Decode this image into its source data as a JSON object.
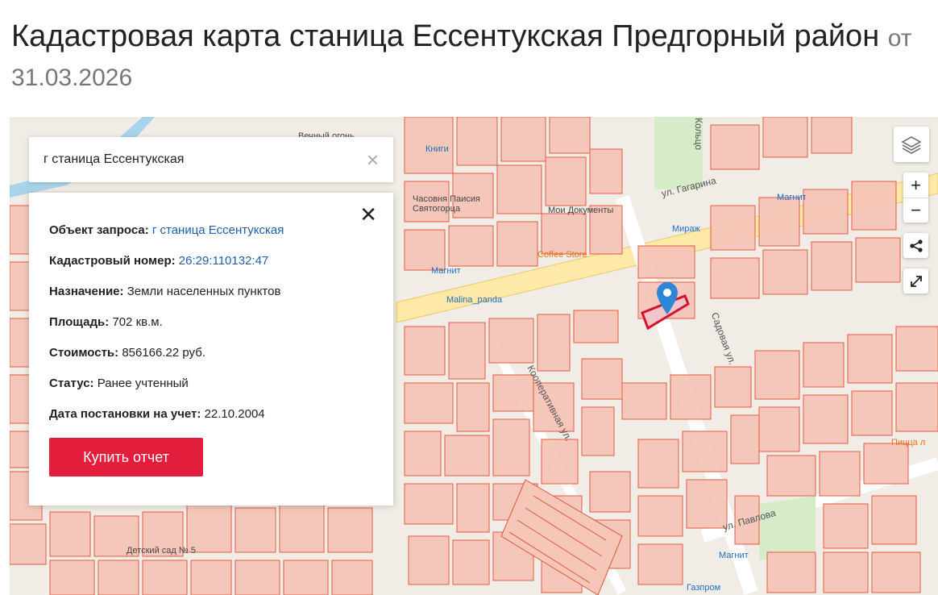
{
  "header": {
    "title": "Кадастровая карта станица Ессентукская Предгорный район",
    "date_text": "от 31.03.2026"
  },
  "search": {
    "value": "г станица Ессентукская",
    "clear_glyph": "×"
  },
  "info": {
    "close_glyph": "✕",
    "rows": [
      {
        "label": "Объект запроса:",
        "value": "г станица Ессентукская",
        "link": true
      },
      {
        "label": "Кадастровый номер:",
        "value": "26:29:110132:47",
        "link": true
      },
      {
        "label": "Назначение:",
        "value": "Земли населенных пунктов",
        "link": false
      },
      {
        "label": "Площадь:",
        "value": "702 кв.м.",
        "link": false
      },
      {
        "label": "Стоимость:",
        "value": "856166.22 руб.",
        "link": false
      },
      {
        "label": "Статус:",
        "value": "Ранее учтенный",
        "link": false
      },
      {
        "label": "Дата постановки на учет:",
        "value": "22.10.2004",
        "link": false
      }
    ],
    "buy_button": "Купить отчет"
  },
  "map_controls": {
    "zoom_in": "+",
    "zoom_out": "−"
  },
  "map_labels": {
    "knigi": "Книги",
    "chasovnya": "Часовня Паисия Святогорца",
    "moi_dokumenty": "Мои Документы",
    "mirazh": "Мираж",
    "magnit1": "Магнит",
    "magnit2": "Магнит",
    "magnit3": "Магнит",
    "coffee": "Coffee Store",
    "malina": "Malina_panda",
    "gagarina": "ул. Гагарина",
    "pavlova": "ул. Павлова",
    "sadovaya": "Садовая ул.",
    "kooperativnaya": "Кооперативная ул.",
    "detsad": "Детский сад № 5",
    "gazprom": "Газпром",
    "pizza": "Пицца л",
    "vechny": "Вечный огонь",
    "koltso": "Кольцо"
  },
  "colors": {
    "accent_red": "#e31e3c",
    "link_blue": "#1f5fa8",
    "parcel_stroke": "#e2553b",
    "parcel_fill": "#f6c6b8"
  }
}
